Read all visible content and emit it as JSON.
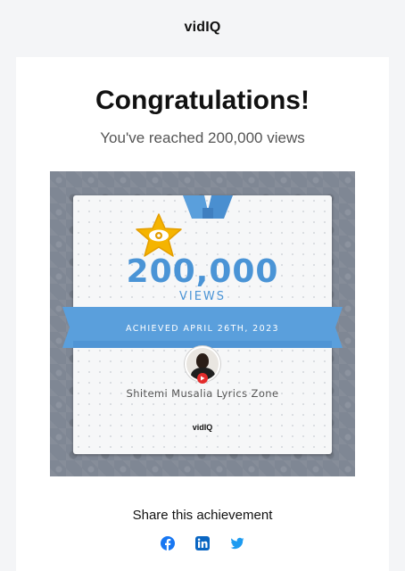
{
  "header": {
    "logo": "vidIQ"
  },
  "hero": {
    "title": "Congratulations!",
    "subtitle": "You've reached 200,000 views"
  },
  "badge": {
    "count": "200,000",
    "unit": "VIEWS",
    "achieved": "ACHIEVED APRIL 26TH, 2023",
    "channel": "Shitemi Musalia Lyrics Zone",
    "logo": "vidIQ",
    "medal_icon": "eye-icon",
    "colors": {
      "accent": "#4a94d6",
      "medal": "#f5b400",
      "frame": "#7f8794"
    }
  },
  "share": {
    "title": "Share this achievement",
    "icons": [
      "facebook-icon",
      "linkedin-icon",
      "twitter-icon"
    ]
  }
}
